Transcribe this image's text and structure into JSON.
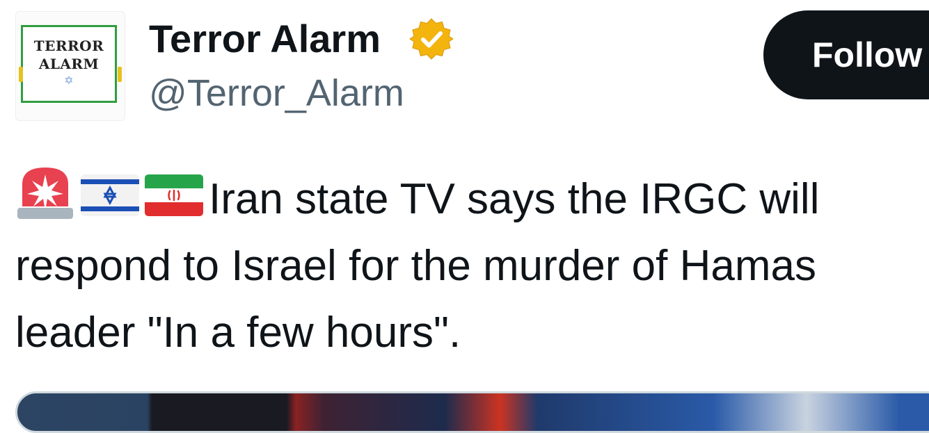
{
  "author": {
    "display_name": "Terror Alarm",
    "handle": "@Terror_Alarm",
    "verified": true,
    "avatar": {
      "logo_line1": "TERROR",
      "logo_line2": "ALARM",
      "logo_symbol": "✡",
      "frame_color": "#2f9e3f"
    }
  },
  "follow_button": {
    "label": "Follow"
  },
  "tweet": {
    "emojis": [
      "police-siren",
      "israel-flag",
      "iran-flag"
    ],
    "text": "Iran state TV says the IRGC will respond to Israel for the murder of Hamas leader \"In a few hours\"."
  },
  "media": {
    "type": "video-thumbnail"
  },
  "colors": {
    "text_primary": "#0f1419",
    "text_secondary": "#536471",
    "button_bg": "#0f1419",
    "verified_gold": "#f4b40e"
  }
}
